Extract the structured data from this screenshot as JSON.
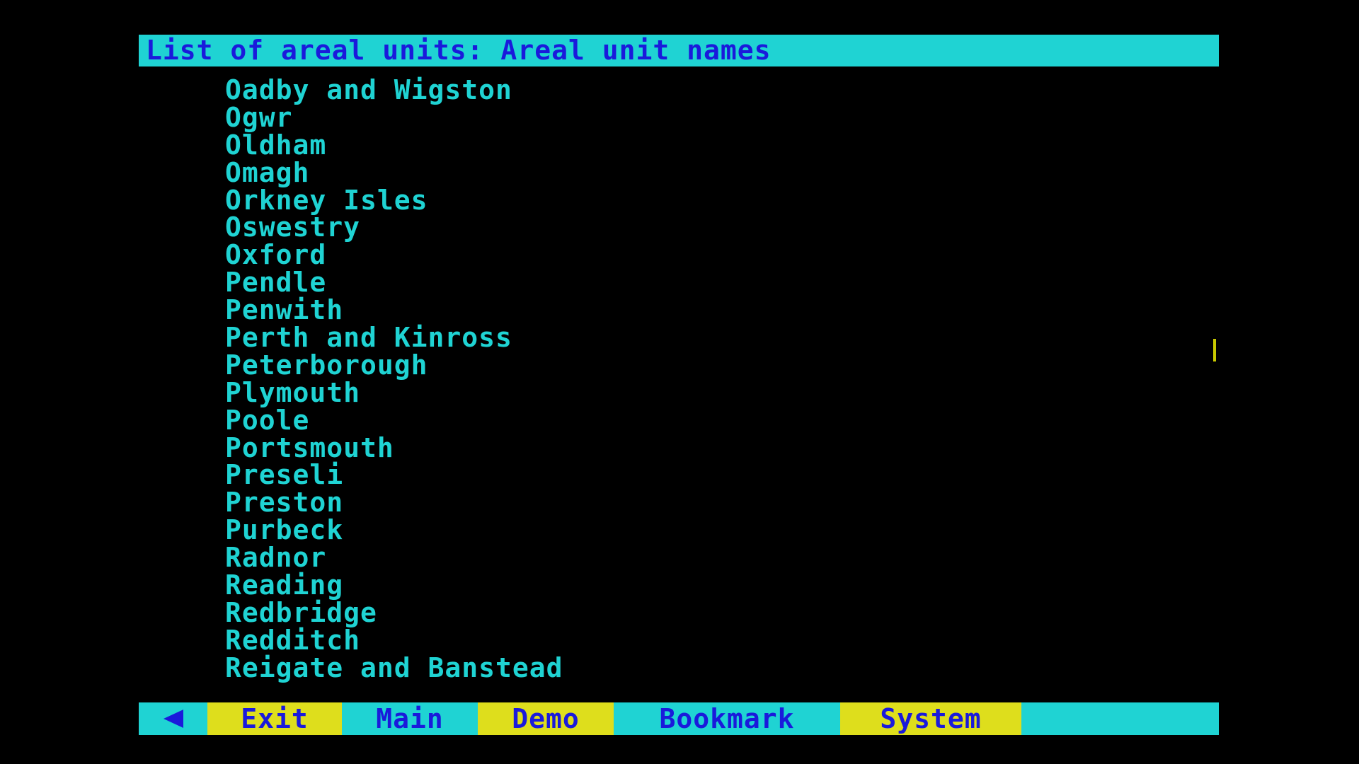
{
  "title": "List of areal units: Areal unit names",
  "areal_units": [
    "Oadby and Wigston",
    "Ogwr",
    "Oldham",
    "Omagh",
    "Orkney Isles",
    "Oswestry",
    "Oxford",
    "Pendle",
    "Penwith",
    "Perth and Kinross",
    "Peterborough",
    "Plymouth",
    "Poole",
    "Portsmouth",
    "Preseli",
    "Preston",
    "Purbeck",
    "Radnor",
    "Reading",
    "Redbridge",
    "Redditch",
    "Reigate and Banstead"
  ],
  "nav": {
    "back_icon": "left-arrow-icon",
    "exit": "Exit",
    "main": "Main",
    "demo": "Demo",
    "bookmark": "Bookmark",
    "system": "System"
  },
  "colors": {
    "background": "#000000",
    "cyan": "#1fd3d3",
    "blue": "#1a1adb",
    "yellow": "#dede1c"
  }
}
